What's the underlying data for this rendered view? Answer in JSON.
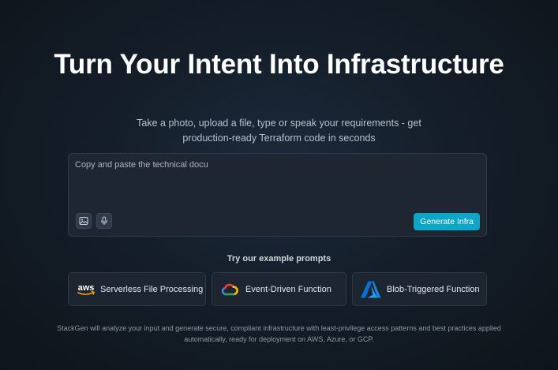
{
  "hero": {
    "title": "Turn Your Intent Into Infrastructure",
    "subtitle_line1": "Take a photo, upload a file, type or speak your requirements - get",
    "subtitle_line2": "production-ready Terraform code in seconds"
  },
  "composer": {
    "placeholder": "Copy and paste the technical docu",
    "value": "",
    "image_icon": "image-upload-icon",
    "mic_icon": "microphone-icon",
    "generate_label": "Generate Infra"
  },
  "prompts": {
    "heading": "Try our example prompts",
    "items": [
      {
        "label": "Serverless File Processing",
        "icon": "aws-logo",
        "logo_text": "aws"
      },
      {
        "label": "Event-Driven Function",
        "icon": "google-cloud-logo"
      },
      {
        "label": "Blob-Triggered Function",
        "icon": "azure-logo"
      }
    ]
  },
  "footer": {
    "line1": "StackGen will analyze your input and generate secure, compliant infrastructure with least-privilege access patterns and best practices applied",
    "line2": "automatically, ready for deployment on AWS, Azure, or GCP."
  },
  "colors": {
    "accent": "#0ea5c6",
    "background": "#141e29",
    "panel": "#1d2631"
  }
}
